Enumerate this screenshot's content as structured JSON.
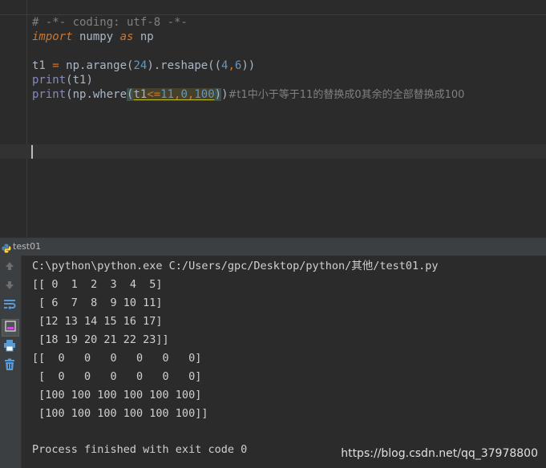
{
  "editor": {
    "line1": {
      "comment": "# -*- coding: utf-8 -*-"
    },
    "line2": {
      "kw_import": "import",
      "module": " numpy ",
      "kw_as": "as",
      "alias": " np"
    },
    "line4": {
      "lhs": "t1 ",
      "eq": "=",
      "call": " np.arange(",
      "num24": "24",
      "reshape": ").reshape((",
      "num4": "4",
      "comma": ",",
      "num6": "6",
      "close": "))"
    },
    "line5": {
      "print": "print",
      "arg": "(t1)"
    },
    "line6": {
      "print": "print",
      "open": "(np.where",
      "paren_open": "(",
      "arg_t1": "t1",
      "arg_le": "<=",
      "arg_11": "11",
      "arg_c1": ",",
      "arg_0": "0",
      "arg_c2": ",",
      "arg_100": "100",
      "paren_close": ")",
      "close": ")",
      "comment": "#t1中小于等于11的替换成0其余的全部替换成100"
    }
  },
  "run": {
    "tab_label": "test01",
    "console_lines": [
      "C:\\python\\python.exe C:/Users/gpc/Desktop/python/其他/test01.py",
      "[[ 0  1  2  3  4  5]",
      " [ 6  7  8  9 10 11]",
      " [12 13 14 15 16 17]",
      " [18 19 20 21 22 23]]",
      "[[  0   0   0   0   0   0]",
      " [  0   0   0   0   0   0]",
      " [100 100 100 100 100 100]",
      " [100 100 100 100 100 100]]",
      "",
      "Process finished with exit code 0"
    ],
    "toolbar_icons": [
      "arrow-up-icon",
      "arrow-down-icon",
      "soft-wrap-icon",
      "scroll-to-end-icon",
      "print-icon",
      "trash-icon"
    ]
  },
  "watermark": "https://blog.csdn.net/qq_37978800",
  "colors": {
    "background": "#2b2b2b",
    "keyword": "#cc7832",
    "number": "#6897bb",
    "builtin": "#8888c6",
    "comment": "#808080",
    "text": "#a9b7c6"
  }
}
